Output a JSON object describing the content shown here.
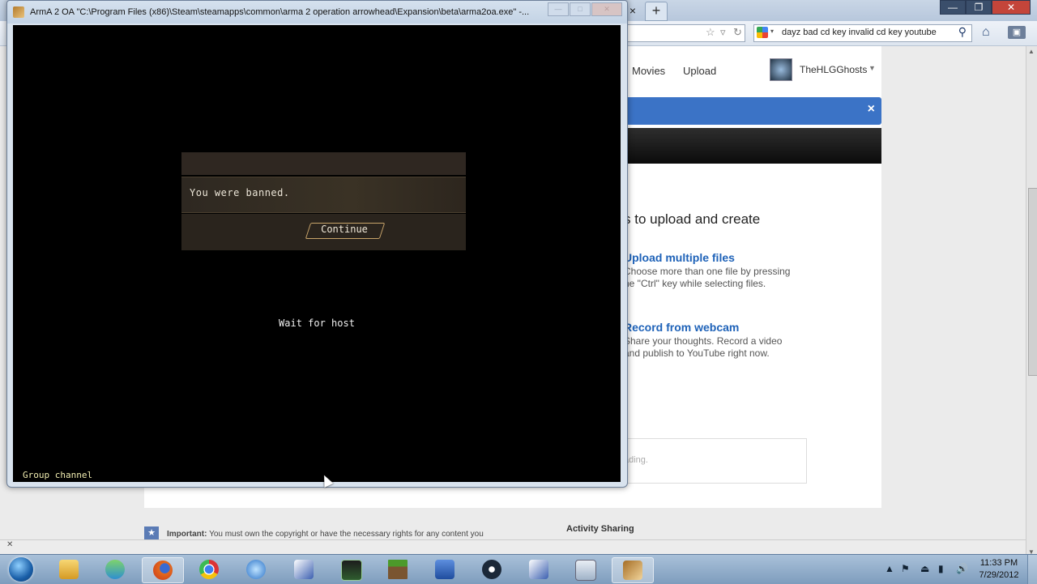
{
  "browser": {
    "new_tab": "+",
    "tab_close": "×",
    "window_controls": {
      "minimize": "—",
      "maximize": "❐",
      "close": "✕"
    },
    "search": {
      "value": "dayz bad cd key invalid cd key youtube"
    }
  },
  "youtube": {
    "nav": {
      "movies": "Movies",
      "upload": "Upload"
    },
    "user": {
      "name": "TheHLGGhosts"
    },
    "notice_close": "×",
    "upload_heading": "s to upload and create",
    "features": [
      {
        "title": "Upload multiple files",
        "desc1": "Choose more than one file by pressing",
        "desc2": "he \"Ctrl\" key while selecting files."
      },
      {
        "title": "Record from webcam",
        "desc1": "Share your thoughts. Record a video",
        "desc2": "and publish to YouTube right now."
      }
    ],
    "upload_status": "ading.",
    "important": {
      "label": "Important:",
      "text": "You must own the copyright or have the necessary rights for any content you"
    },
    "activity_sharing": "Activity Sharing"
  },
  "arma": {
    "title": "ArmA 2 OA \"C:\\Program Files (x86)\\Steam\\steamapps\\common\\arma 2 operation arrowhead\\Expansion\\beta\\arma2oa.exe\" -...",
    "ban_message": "You were banned.",
    "continue_label": "Continue",
    "wait_text": "Wait for host",
    "group_channel": "Group channel"
  },
  "taskbar": {
    "clock_time": "11:33 PM",
    "clock_date": "7/29/2012",
    "apps": [
      "windows-explorer",
      "windows-live-messenger",
      "firefox",
      "chrome",
      "itunes",
      "launcher",
      "terminal",
      "minecraft",
      "word",
      "steam",
      "launcher-2",
      "folder",
      "arma2"
    ]
  }
}
